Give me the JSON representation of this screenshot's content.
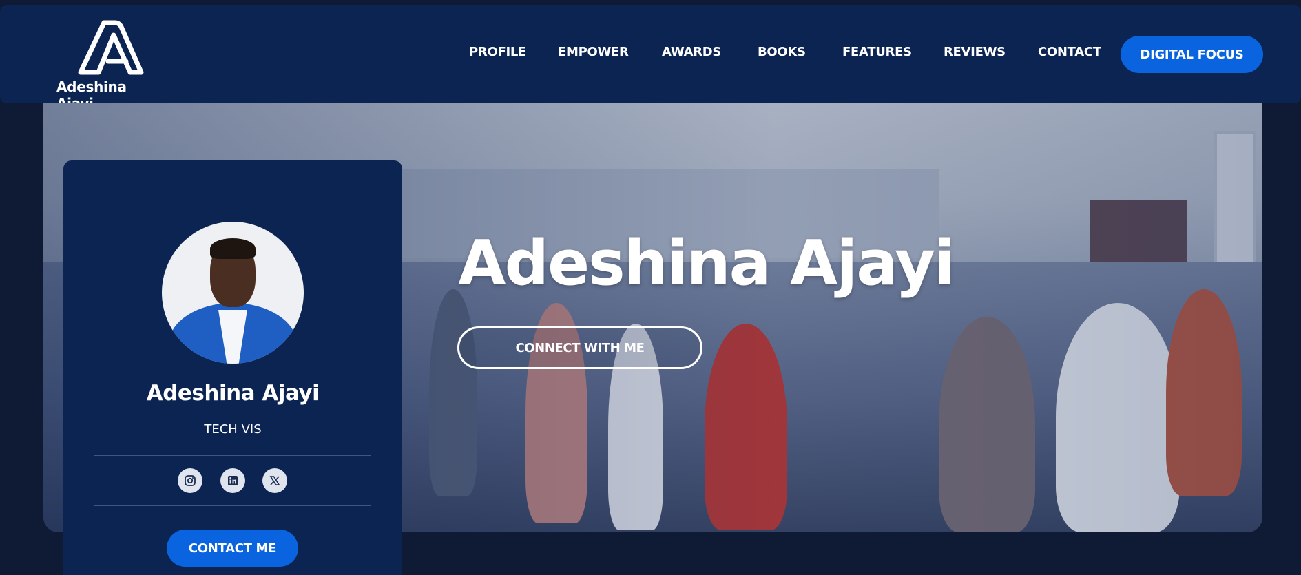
{
  "header": {
    "logo_text": "Adeshina Ajayi",
    "nav": [
      "PROFILE",
      "EMPOWER",
      "AWARDS",
      "BOOKS",
      "FEATURES",
      "REVIEWS",
      "CONTACT"
    ],
    "cta_label": "DIGITAL FOCUS"
  },
  "hero": {
    "title": "Adeshina Ajayi",
    "connect_label": "CONNECT WITH ME"
  },
  "card": {
    "name": "Adeshina Ajayi",
    "role": "TECH VIS",
    "social_icons": [
      "instagram-icon",
      "linkedin-icon",
      "x-icon"
    ],
    "contact_label": "CONTACT ME"
  },
  "colors": {
    "page_bg": "#0f1a35",
    "header_bg": "#0b2452",
    "accent": "#0a64e0",
    "text": "#ffffff"
  }
}
